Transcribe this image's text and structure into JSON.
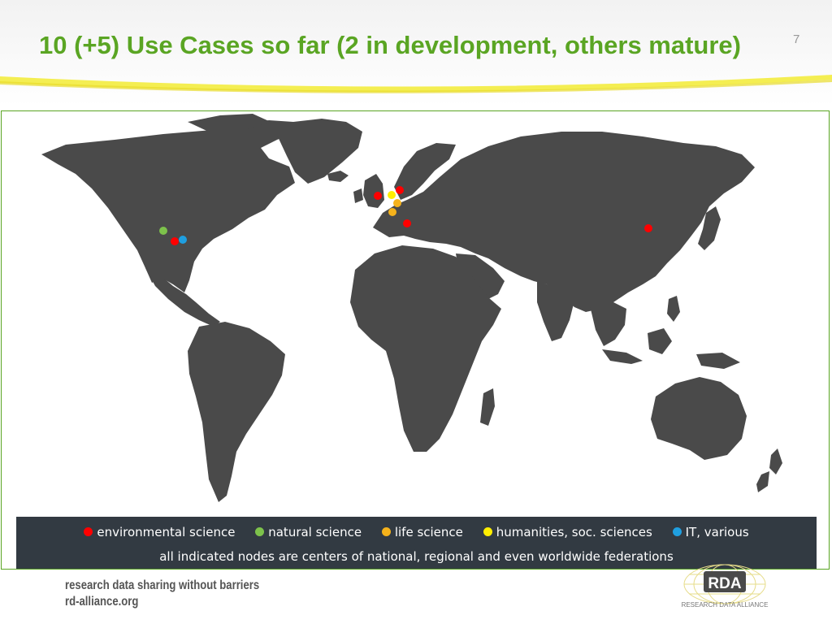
{
  "slide": {
    "title": "10 (+5) Use Cases so far (2 in development, others mature)",
    "number": "7"
  },
  "colors": {
    "title": "#5aa523",
    "land": "#4a4a4a",
    "legend_bg": "#323a42",
    "environmental": "#ff0000",
    "natural": "#7dc24b",
    "life": "#f5b21b",
    "humanities": "#ffee00",
    "it": "#1f9fe0"
  },
  "legend": {
    "items": [
      {
        "label": "environmental science",
        "color": "#ff0000"
      },
      {
        "label": "natural science",
        "color": "#7dc24b"
      },
      {
        "label": "life science",
        "color": "#f5b21b"
      },
      {
        "label": "humanities, soc. sciences",
        "color": "#ffee00"
      },
      {
        "label": "IT, various",
        "color": "#1f9fe0"
      }
    ],
    "note": "all indicated nodes are centers of national, regional and even worldwide federations"
  },
  "footer": {
    "tagline": "research data sharing without barriers",
    "url": "rd-alliance.org",
    "logo_text": "RDA",
    "logo_caption": "RESEARCH DATA ALLIANCE"
  }
}
